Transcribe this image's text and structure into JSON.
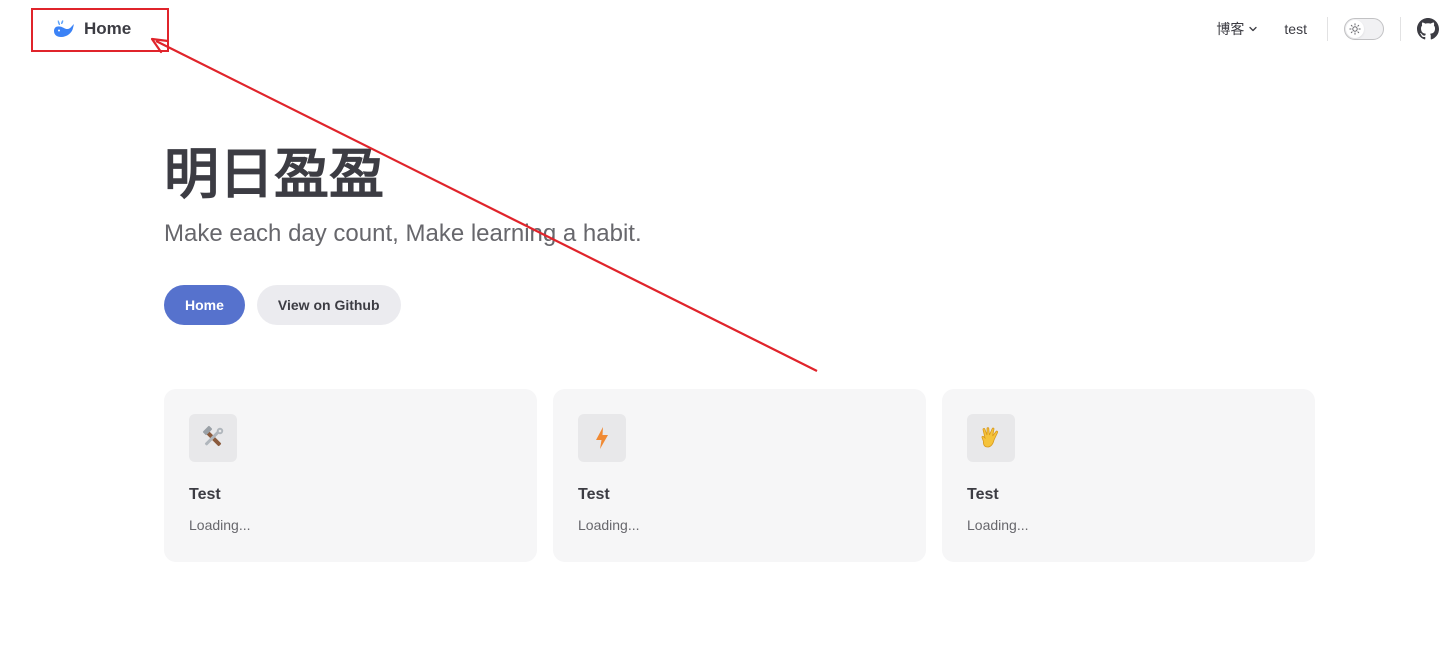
{
  "nav": {
    "brand_title": "Home",
    "brand_icon": "whale-icon",
    "links": [
      {
        "label": "博客",
        "has_dropdown": true
      },
      {
        "label": "test",
        "has_dropdown": false
      }
    ],
    "appearance_toggle_icon": "sun-icon",
    "social_icon": "github-icon"
  },
  "hero": {
    "name": "明日盈盈",
    "tagline": "Make each day count, Make learning a habit.",
    "actions": [
      {
        "label": "Home",
        "theme": "brand"
      },
      {
        "label": "View on Github",
        "theme": "alt"
      }
    ]
  },
  "features": [
    {
      "icon": "hammer-and-wrench-icon",
      "title": "Test",
      "details": "Loading..."
    },
    {
      "icon": "lightning-icon",
      "title": "Test",
      "details": "Loading..."
    },
    {
      "icon": "vulcan-salute-icon",
      "title": "Test",
      "details": "Loading..."
    }
  ],
  "colors": {
    "brand": "#5672cd",
    "annotation": "#e0242b",
    "card_bg": "#f6f6f7",
    "text": "#3c3c43"
  }
}
